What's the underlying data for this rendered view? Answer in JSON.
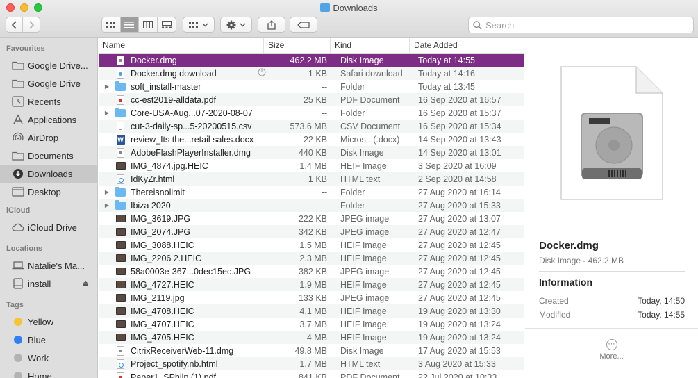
{
  "window": {
    "title": "Downloads"
  },
  "search": {
    "placeholder": "Search",
    "value": ""
  },
  "toolbar": {
    "back_icon": "chevron-left-icon",
    "forward_icon": "chevron-right-icon",
    "view_modes": [
      "icon-view",
      "list-view",
      "column-view",
      "gallery-view"
    ],
    "selected_view": "list-view"
  },
  "sidebar": {
    "favourites_label": "Favourites",
    "favourites": [
      {
        "label": "Google Drive...",
        "icon": "folder-icon"
      },
      {
        "label": "Google Drive",
        "icon": "folder-icon"
      },
      {
        "label": "Recents",
        "icon": "clock-icon"
      },
      {
        "label": "Applications",
        "icon": "applications-icon"
      },
      {
        "label": "AirDrop",
        "icon": "airdrop-icon"
      },
      {
        "label": "Documents",
        "icon": "folder-icon"
      },
      {
        "label": "Downloads",
        "icon": "downloads-icon"
      },
      {
        "label": "Desktop",
        "icon": "desktop-icon"
      }
    ],
    "icloud_label": "iCloud",
    "icloud": [
      {
        "label": "iCloud Drive",
        "icon": "cloud-icon"
      }
    ],
    "locations_label": "Locations",
    "locations": [
      {
        "label": "Natalie's Ma...",
        "icon": "laptop-icon"
      },
      {
        "label": "install",
        "icon": "disk-icon"
      }
    ],
    "tags_label": "Tags",
    "tags": [
      {
        "label": "Yellow",
        "color": "#f7c531"
      },
      {
        "label": "Blue",
        "color": "#2f7ff6"
      },
      {
        "label": "Work",
        "color": "#b3b3b3"
      },
      {
        "label": "Home",
        "color": "#b3b3b3"
      }
    ]
  },
  "columns": {
    "name": "Name",
    "size": "Size",
    "kind": "Kind",
    "date": "Date Added"
  },
  "files": [
    {
      "name": "Docker.dmg",
      "size": "462.2 MB",
      "kind": "Disk Image",
      "date": "Today at 14:55",
      "icon": "dmg"
    },
    {
      "name": "Docker.dmg.download",
      "size": "1 KB",
      "kind": "Safari download",
      "date": "Today at 14:16",
      "icon": "safari"
    },
    {
      "name": "soft_install-master",
      "size": "--",
      "kind": "Folder",
      "date": "Today at 13:45",
      "icon": "folder"
    },
    {
      "name": "cc-est2019-alldata.pdf",
      "size": "25 KB",
      "kind": "PDF Document",
      "date": "16 Sep 2020 at 16:57",
      "icon": "pdf"
    },
    {
      "name": "Core-USA-Aug...07-2020-08-07",
      "size": "--",
      "kind": "Folder",
      "date": "16 Sep 2020 at 15:37",
      "icon": "folder"
    },
    {
      "name": "cut-3-daily-sp...5-20200515.csv",
      "size": "573.6 MB",
      "kind": "CSV Document",
      "date": "16 Sep 2020 at 15:34",
      "icon": "csv"
    },
    {
      "name": "review_Its the...retail sales.docx",
      "size": "22 KB",
      "kind": "Micros...(.docx)",
      "date": "14 Sep 2020 at 13:43",
      "icon": "word"
    },
    {
      "name": "AdobeFlashPlayerInstaller.dmg",
      "size": "440 KB",
      "kind": "Disk Image",
      "date": "14 Sep 2020 at 13:01",
      "icon": "dmg"
    },
    {
      "name": "IMG_4874.jpg.HEIC",
      "size": "1.4 MB",
      "kind": "HEIF Image",
      "date": "3 Sep 2020 at 16:09",
      "icon": "img"
    },
    {
      "name": "IdKyZr.html",
      "size": "1 KB",
      "kind": "HTML text",
      "date": "2 Sep 2020 at 14:58",
      "icon": "html"
    },
    {
      "name": "Thereisnolimit",
      "size": "--",
      "kind": "Folder",
      "date": "27 Aug 2020 at 16:14",
      "icon": "folder"
    },
    {
      "name": "Ibiza 2020",
      "size": "--",
      "kind": "Folder",
      "date": "27 Aug 2020 at 15:33",
      "icon": "folder"
    },
    {
      "name": "IMG_3619.JPG",
      "size": "222 KB",
      "kind": "JPEG image",
      "date": "27 Aug 2020 at 13:07",
      "icon": "img"
    },
    {
      "name": "IMG_2074.JPG",
      "size": "342 KB",
      "kind": "JPEG image",
      "date": "27 Aug 2020 at 12:47",
      "icon": "img"
    },
    {
      "name": "IMG_3088.HEIC",
      "size": "1.5 MB",
      "kind": "HEIF Image",
      "date": "27 Aug 2020 at 12:45",
      "icon": "img"
    },
    {
      "name": "IMG_2206 2.HEIC",
      "size": "2.3 MB",
      "kind": "HEIF Image",
      "date": "27 Aug 2020 at 12:45",
      "icon": "img"
    },
    {
      "name": "58a0003e-367...0dec15ec.JPG",
      "size": "382 KB",
      "kind": "JPEG image",
      "date": "27 Aug 2020 at 12:45",
      "icon": "img"
    },
    {
      "name": "IMG_4727.HEIC",
      "size": "1.9 MB",
      "kind": "HEIF Image",
      "date": "27 Aug 2020 at 12:45",
      "icon": "img"
    },
    {
      "name": "IMG_2119.jpg",
      "size": "133 KB",
      "kind": "JPEG image",
      "date": "27 Aug 2020 at 12:45",
      "icon": "img"
    },
    {
      "name": "IMG_4708.HEIC",
      "size": "4.1 MB",
      "kind": "HEIF Image",
      "date": "19 Aug 2020 at 13:30",
      "icon": "img"
    },
    {
      "name": "IMG_4707.HEIC",
      "size": "3.7 MB",
      "kind": "HEIF Image",
      "date": "19 Aug 2020 at 13:24",
      "icon": "img"
    },
    {
      "name": "IMG_4705.HEIC",
      "size": "4 MB",
      "kind": "HEIF Image",
      "date": "19 Aug 2020 at 13:24",
      "icon": "img"
    },
    {
      "name": "CitrixReceiverWeb-11.dmg",
      "size": "49.8 MB",
      "kind": "Disk Image",
      "date": "17 Aug 2020 at 15:53",
      "icon": "dmg"
    },
    {
      "name": "Project_spotify.nb.html",
      "size": "1.7 MB",
      "kind": "HTML text",
      "date": "3 Aug 2020 at 15:33",
      "icon": "html"
    },
    {
      "name": "Paper1_SPhilp (1).pdf",
      "size": "841 KB",
      "kind": "PDF Document",
      "date": "22 Jul 2020 at 10:33",
      "icon": "pdf"
    }
  ],
  "preview": {
    "name": "Docker.dmg",
    "subtitle": "Disk Image - 462.2 MB",
    "info_heading": "Information",
    "created_label": "Created",
    "created_value": "Today, 14:50",
    "modified_label": "Modified",
    "modified_value": "Today, 14:55",
    "more_label": "More..."
  },
  "colors": {
    "selection": "#7d2d85",
    "sidebar_bg": "#dedede",
    "folder": "#6cb8f2"
  }
}
